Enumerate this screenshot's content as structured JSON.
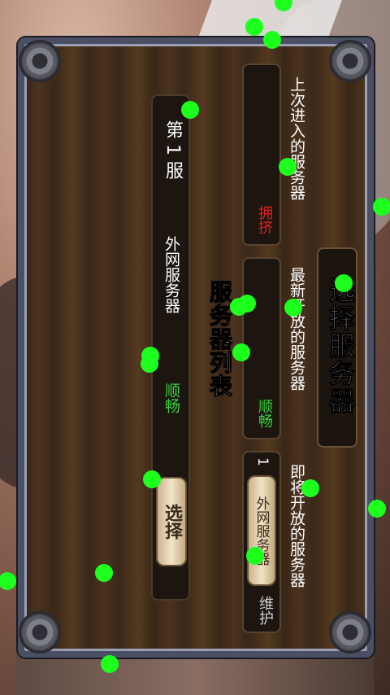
{
  "dialog": {
    "title": "选择服务器",
    "sections": {
      "last": {
        "label": "上次进入的服务器",
        "status": "拥挤"
      },
      "newest": {
        "label": "最新开放的服务器",
        "status": "顺畅"
      },
      "upcoming": {
        "label": "即将开放的服务器",
        "number": "1",
        "server_name": "外网服务器",
        "status": "维护"
      }
    },
    "list_title": "服务器列表",
    "server_list": [
      {
        "name": "第 1 服",
        "type": "外网服务器",
        "status": "顺畅",
        "select_label": "选择"
      }
    ]
  },
  "colors": {
    "status_busy": "#e02020",
    "status_smooth": "#36d13a",
    "panel_frame": "#4a4f63",
    "button_face": "#f1e2c4"
  }
}
